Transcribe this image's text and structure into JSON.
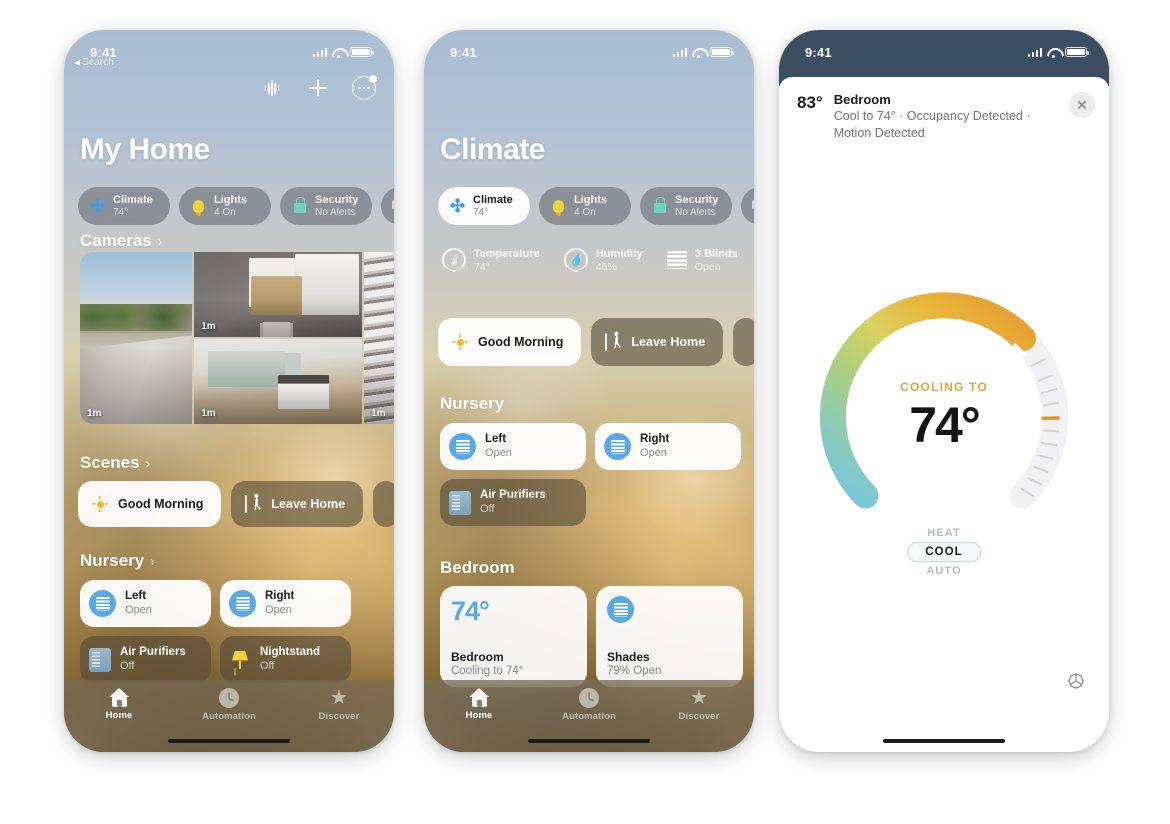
{
  "phone1": {
    "statusbar": {
      "time": "9:41"
    },
    "back_label": "Search",
    "header_icons": [
      "waveform-icon",
      "plus-icon",
      "more-circle-icon"
    ],
    "title": "My Home",
    "pills": [
      {
        "icon": "fan-icon",
        "title": "Climate",
        "subtitle": "74°",
        "selected": false
      },
      {
        "icon": "bulb-icon",
        "title": "Lights",
        "subtitle": "4 On",
        "selected": false
      },
      {
        "icon": "lock-icon",
        "title": "Security",
        "subtitle": "No Alerts",
        "selected": false
      },
      {
        "icon": "speaker-tv-icon",
        "title": "",
        "subtitle": "",
        "selected": false
      }
    ],
    "cameras_header": "Cameras",
    "cameras": [
      {
        "name": "driveway-camera",
        "time": "1m"
      },
      {
        "name": "nursery-camera",
        "time": "1m"
      },
      {
        "name": "living-room-camera",
        "time": "1m"
      },
      {
        "name": "stairs-camera",
        "time": "1m"
      }
    ],
    "scenes_header": "Scenes",
    "scenes": [
      {
        "icon": "sun-icon",
        "label": "Good Morning",
        "selected": true
      },
      {
        "icon": "walk-icon",
        "label": "Leave Home",
        "selected": false
      }
    ],
    "nursery_header": "Nursery",
    "nursery_tiles": [
      {
        "icon": "blind-icon",
        "title": "Left",
        "state": "Open",
        "on": true
      },
      {
        "icon": "blind-icon",
        "title": "Right",
        "state": "Open",
        "on": true
      },
      {
        "icon": "purifier-icon",
        "title": "Air Purifiers",
        "state": "Off",
        "on": false
      },
      {
        "icon": "lamp-icon",
        "title": "Nightstand",
        "state": "Off",
        "on": false
      }
    ],
    "tabs": [
      {
        "icon": "home-icon",
        "label": "Home",
        "active": true
      },
      {
        "icon": "clock-icon",
        "label": "Automation",
        "active": false
      },
      {
        "icon": "star-icon",
        "label": "Discover",
        "active": false
      }
    ]
  },
  "phone2": {
    "statusbar": {
      "time": "9:41"
    },
    "title": "Climate",
    "pills": [
      {
        "icon": "fan-icon",
        "title": "Climate",
        "subtitle": "74°",
        "selected": true
      },
      {
        "icon": "bulb-icon",
        "title": "Lights",
        "subtitle": "4 On",
        "selected": false
      },
      {
        "icon": "lock-icon",
        "title": "Security",
        "subtitle": "No Alerts",
        "selected": false
      },
      {
        "icon": "speaker-tv-icon",
        "title": "",
        "subtitle": "",
        "selected": false
      }
    ],
    "status_items": [
      {
        "icon": "thermometer-gauge-icon",
        "title": "Temperature",
        "value": "74°"
      },
      {
        "icon": "humidity-gauge-icon",
        "title": "Humidity",
        "value": "46%"
      },
      {
        "icon": "blinds-icon",
        "title": "3 Blinds",
        "value": "Open"
      }
    ],
    "scenes": [
      {
        "icon": "sun-icon",
        "label": "Good Morning",
        "selected": true
      },
      {
        "icon": "walk-icon",
        "label": "Leave Home",
        "selected": false
      }
    ],
    "nursery_header": "Nursery",
    "nursery_tiles": [
      {
        "icon": "blind-icon",
        "title": "Left",
        "state": "Open",
        "on": true
      },
      {
        "icon": "blind-icon",
        "title": "Right",
        "state": "Open",
        "on": true
      },
      {
        "icon": "purifier-icon",
        "title": "Air Purifiers",
        "state": "Off",
        "on": false
      }
    ],
    "bedroom_header": "Bedroom",
    "bedroom_tiles": [
      {
        "icon": "thermostat-icon",
        "big_value": "74°",
        "title": "Bedroom",
        "state": "Cooling to 74°"
      },
      {
        "icon": "blind-icon",
        "big_value": "",
        "title": "Shades",
        "state": "79% Open"
      }
    ],
    "tabs": [
      {
        "icon": "home-icon",
        "label": "Home",
        "active": true
      },
      {
        "icon": "clock-icon",
        "label": "Automation",
        "active": false
      },
      {
        "icon": "star-icon",
        "label": "Discover",
        "active": false
      }
    ]
  },
  "phone3": {
    "statusbar": {
      "time": "9:41"
    },
    "current_temp": "83°",
    "name": "Bedroom",
    "subtitle": "Cool to 74° · Occupancy Detected · Motion Detected",
    "close_icon": "close-icon",
    "dial": {
      "mode_label": "COOLING TO",
      "target": "74°",
      "accent_color": "#e5a13c",
      "arc_colors": [
        "#6ec6e0",
        "#8fc9a8",
        "#cdd36a",
        "#e9b63c",
        "#e8a63a"
      ],
      "track_color": "#f2f2f4",
      "marker_color": "#e5941f"
    },
    "modes": [
      {
        "label": "HEAT",
        "selected": false
      },
      {
        "label": "COOL",
        "selected": true
      },
      {
        "label": "AUTO",
        "selected": false
      }
    ],
    "settings_icon": "gear-icon"
  }
}
